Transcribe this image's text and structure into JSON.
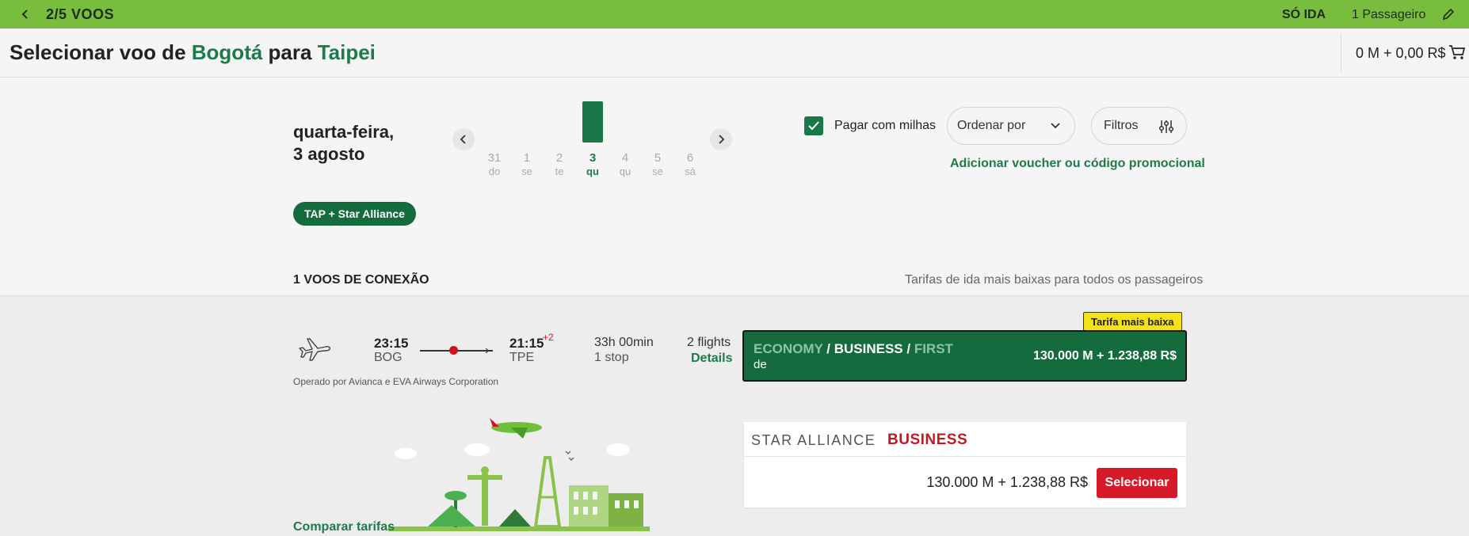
{
  "topbar": {
    "step": "2/5 VOOS",
    "trip_type": "SÓ IDA",
    "passengers": "1 Passageiro"
  },
  "header": {
    "title_prefix": "Selecionar voo de",
    "origin": "Bogotá",
    "title_middle": "para",
    "destination": "Taipei",
    "cart_total": "0 M + 0,00 R$"
  },
  "date_selector": {
    "current_line1": "quarta-feira,",
    "current_line2": "3 agosto",
    "days": [
      {
        "num": "31",
        "dow": "do"
      },
      {
        "num": "1",
        "dow": "se"
      },
      {
        "num": "2",
        "dow": "te"
      },
      {
        "num": "3",
        "dow": "qu"
      },
      {
        "num": "4",
        "dow": "qu"
      },
      {
        "num": "5",
        "dow": "se"
      },
      {
        "num": "6",
        "dow": "sá"
      }
    ]
  },
  "options": {
    "pay_with_miles": "Pagar com milhas",
    "sort_by": "Ordenar por",
    "filters": "Filtros",
    "voucher": "Adicionar voucher ou código promocional",
    "alliance_tag": "TAP + Star Alliance"
  },
  "results": {
    "section_title": "1 VOOS DE CONEXÃO",
    "section_note": "Tarifas de ida mais baixas para todos os passageiros"
  },
  "flight": {
    "dep_time": "23:15",
    "dep_code": "BOG",
    "arr_time": "21:15",
    "arr_plus_days": "+2",
    "arr_code": "TPE",
    "duration": "33h 00min",
    "stops": "1 stop",
    "flights_count": "2 flights",
    "details_link": "Details",
    "operated_by": "Operado por Avianca e EVA Airways Corporation"
  },
  "fare": {
    "badge": "Tarifa mais baixa",
    "cabin_economy": "ECONOMY",
    "sep1": " / ",
    "cabin_business": "BUSINESS",
    "sep2": " / ",
    "cabin_first": "FIRST",
    "from_label": "de",
    "price": "130.000 M + 1.238,88 R$"
  },
  "fare_card": {
    "brand": "STAR ALLIANCE",
    "cabin": "BUSINESS",
    "price": "130.000 M + 1.238,88 R$",
    "select_label": "Selecionar"
  },
  "compare_link": "Comparar tarifas",
  "colors": {
    "topbar": "#78bd3e",
    "brand_green": "#146b3e",
    "link_green": "#1f7a4a",
    "select_red": "#d71a27",
    "badge_yellow": "#f5e11a"
  }
}
